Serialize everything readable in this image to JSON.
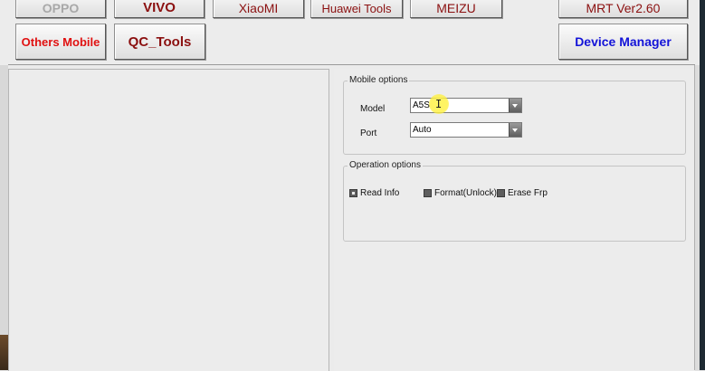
{
  "toolbar": {
    "row1": [
      "OPPO",
      "VIVO",
      "XiaoMI",
      "Huawei Tools",
      "MEIZU",
      "MRT Ver2.60"
    ],
    "others_mobile": "Others Mobile",
    "qc_tools": "QC_Tools",
    "device_manager": "Device Manager"
  },
  "mobile_options": {
    "legend": "Mobile options",
    "model_label": "Model",
    "model_value": "A5S",
    "port_label": "Port",
    "port_value": "Auto"
  },
  "operation_options": {
    "legend": "Operation options",
    "read_info": "Read Info",
    "format_unlock": "Format(Unlock)",
    "erase_frp": "Erase Frp",
    "read_info_checked": true,
    "format_unlock_checked": false,
    "erase_frp_checked": false
  },
  "colors": {
    "dark_red_text": "#8b1010",
    "red_text": "#e01010",
    "blue_text": "#1212d8",
    "disabled_text": "#a8a8a8",
    "cursor_highlight": "#fff05a"
  },
  "icons": [
    "combo-arrow-icon",
    "checkbox-icon",
    "text-cursor-icon"
  ]
}
